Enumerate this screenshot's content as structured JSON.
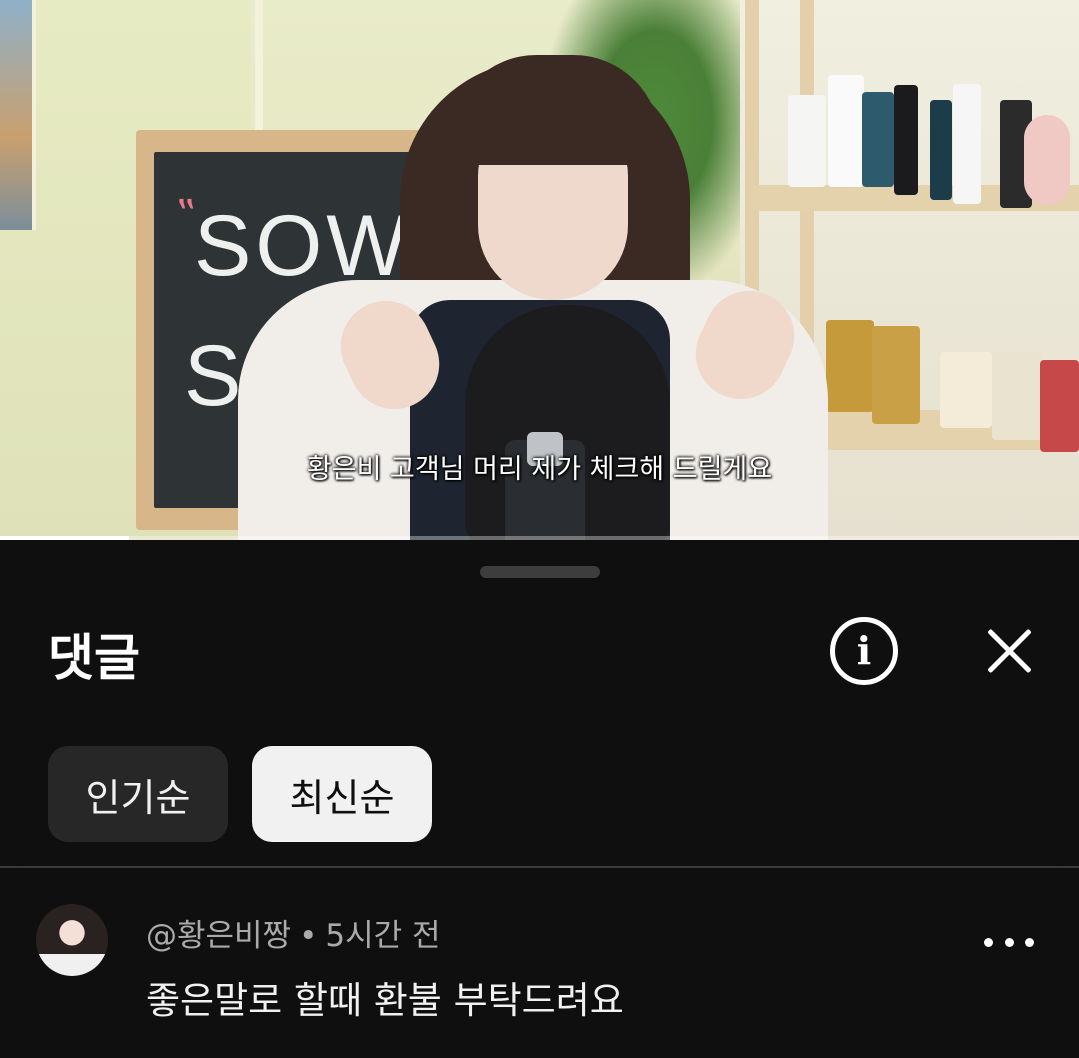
{
  "video": {
    "subtitle": "황은비 고객님 머리 제가 체크해 드릴게요",
    "chalkboard_line1": "SOWON",
    "chalkboard_line2": "SAL",
    "progress_fraction": 0.12
  },
  "comments_sheet": {
    "title": "댓글",
    "info_icon": "info-icon",
    "close_icon": "close-icon",
    "sort_chips": [
      {
        "label": "인기순",
        "selected": false
      },
      {
        "label": "최신순",
        "selected": true
      }
    ],
    "comments": [
      {
        "author": "@황은비짱",
        "separator": "•",
        "time": "5시간 전",
        "text": "좋은말로 할때 환불 부탁드려요",
        "more_icon": "more-vertical-icon"
      }
    ]
  }
}
